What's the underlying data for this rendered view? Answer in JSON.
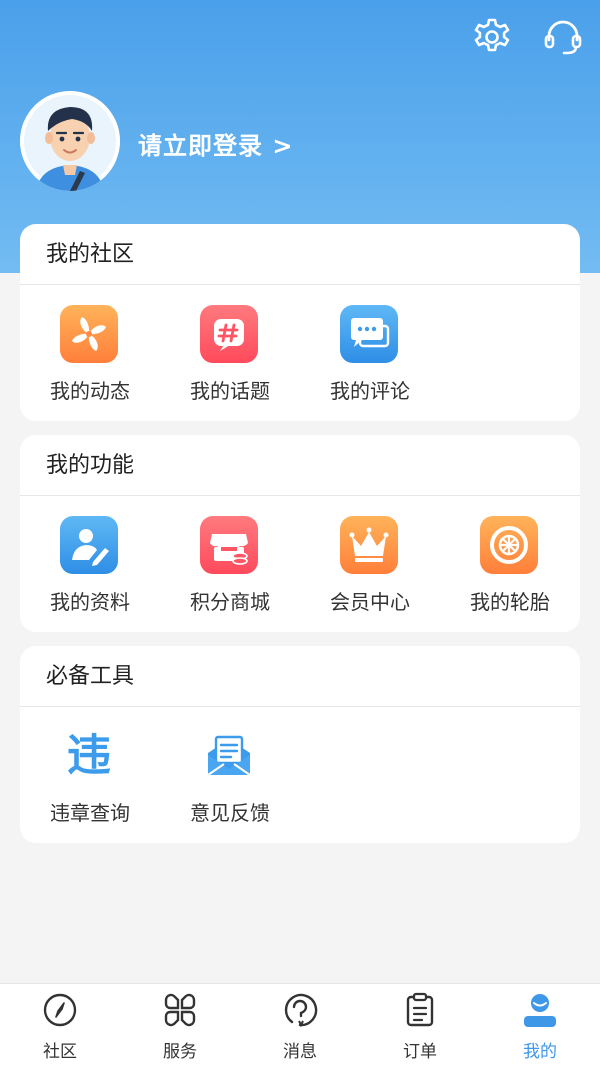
{
  "header": {
    "login_text": "请立即登录 >",
    "icons": {
      "settings": "gear-icon",
      "support": "headset-icon"
    }
  },
  "sections": [
    {
      "title": "我的社区",
      "items": [
        {
          "label": "我的动态",
          "icon": "pinwheel-icon",
          "color": "#ff8c42"
        },
        {
          "label": "我的话题",
          "icon": "hashtag-icon",
          "color": "#ff5564"
        },
        {
          "label": "我的评论",
          "icon": "comment-icon",
          "color": "#3d9bec"
        }
      ]
    },
    {
      "title": "我的功能",
      "items": [
        {
          "label": "我的资料",
          "icon": "profile-edit-icon",
          "color": "#3d9bec"
        },
        {
          "label": "积分商城",
          "icon": "store-icon",
          "color": "#ff5564"
        },
        {
          "label": "会员中心",
          "icon": "crown-icon",
          "color": "#ff8c42"
        },
        {
          "label": "我的轮胎",
          "icon": "tire-icon",
          "color": "#ff8c42"
        }
      ]
    },
    {
      "title": "必备工具",
      "items": [
        {
          "label": "违章查询",
          "icon": "violation-icon",
          "icon_text": "违",
          "color": "#3d9bec"
        },
        {
          "label": "意见反馈",
          "icon": "feedback-mail-icon",
          "color": "#3d9bec"
        }
      ]
    }
  ],
  "tabbar": {
    "active_color": "#3f97e8",
    "tabs": [
      {
        "label": "社区",
        "icon": "compass-icon",
        "active": false
      },
      {
        "label": "服务",
        "icon": "grid-icon",
        "active": false
      },
      {
        "label": "消息",
        "icon": "message-icon",
        "active": false
      },
      {
        "label": "订单",
        "icon": "order-clipboard-icon",
        "active": false
      },
      {
        "label": "我的",
        "icon": "user-icon",
        "active": true
      }
    ]
  }
}
